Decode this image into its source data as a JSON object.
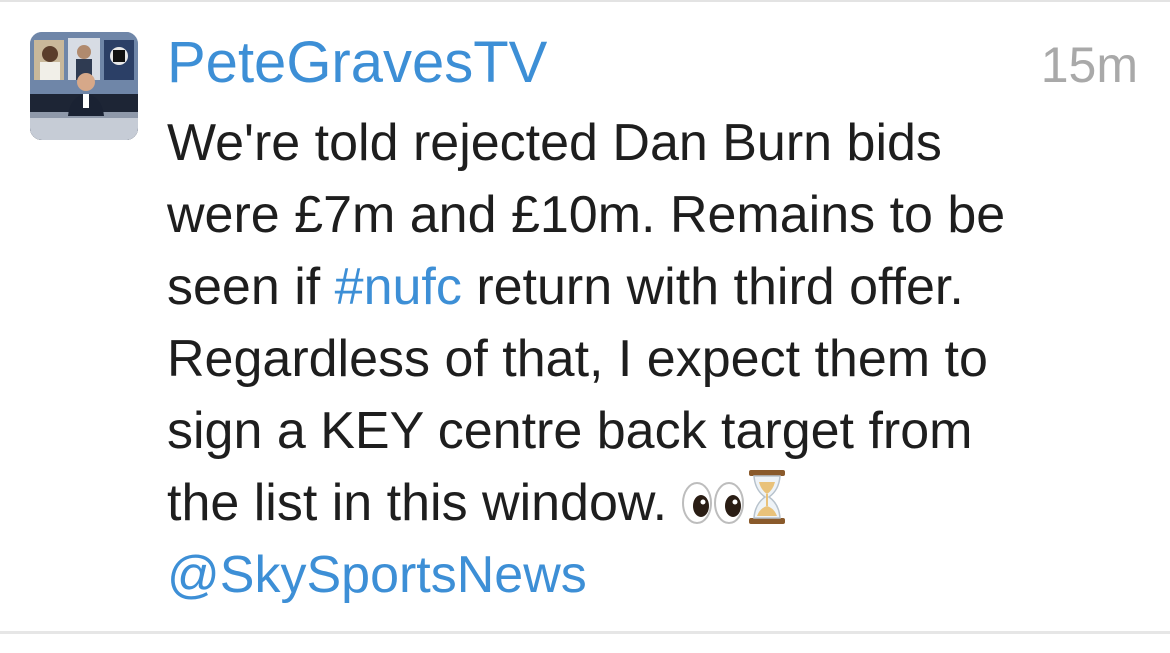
{
  "tweet": {
    "display_name": "PeteGravesTV",
    "timestamp": "15m",
    "body": {
      "line1": "We're told rejected Dan Burn bids",
      "line2": "were £7m and £10m. Remains to be",
      "line3_pre": "seen if ",
      "line3_hashtag": "#nufc",
      "line3_post": " return with third offer.",
      "line4": "Regardless of that, I expect them to",
      "line5": "sign a KEY centre back target from",
      "line6": "the list in this window. ",
      "mention": "@SkySportsNews"
    },
    "emoji": [
      "eyes",
      "hourglass"
    ]
  },
  "colors": {
    "link": "#3d8fd6",
    "text": "#1e1e1e",
    "timestamp": "#a9a9a9"
  }
}
